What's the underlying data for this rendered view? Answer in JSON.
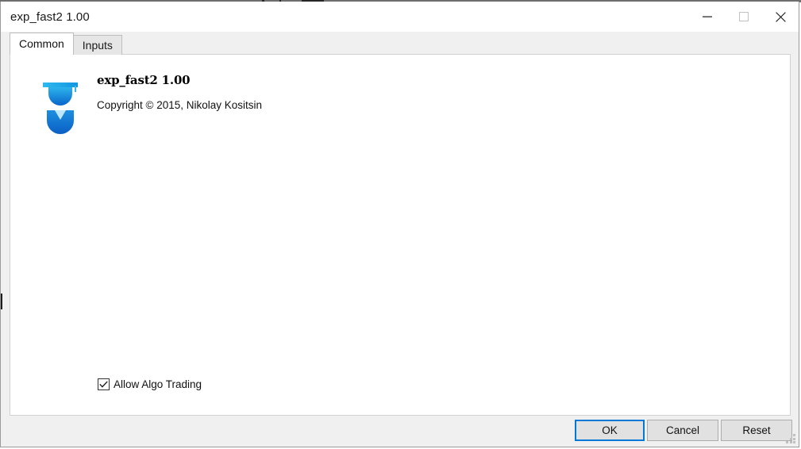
{
  "window": {
    "title": "exp_fast2 1.00",
    "controls": [
      {
        "name": "minimize",
        "glyph": "minimize-icon",
        "enabled": true
      },
      {
        "name": "maximize",
        "glyph": "maximize-icon",
        "enabled": false
      },
      {
        "name": "close",
        "glyph": "close-icon",
        "enabled": true
      }
    ]
  },
  "tabs": [
    {
      "label": "Common",
      "active": true
    },
    {
      "label": "Inputs",
      "active": false
    }
  ],
  "product": {
    "icon_name": "graduation-cap-expert-icon",
    "title": "exp_fast2 1.00",
    "copyright": "Copyright © 2015, Nikolay Kositsin"
  },
  "options": {
    "allow_algo_trading": {
      "label": "Allow Algo Trading",
      "checked": true
    }
  },
  "footer": {
    "ok_label": "OK",
    "cancel_label": "Cancel",
    "reset_label": "Reset"
  },
  "colors": {
    "accent": "#0078d7",
    "icon_primary": "#0b6ed6",
    "icon_light": "#29b5ef",
    "window_bg": "#f0f0f0",
    "panel_bg": "#ffffff",
    "button_face": "#e1e1e1",
    "button_border": "#adadad"
  }
}
